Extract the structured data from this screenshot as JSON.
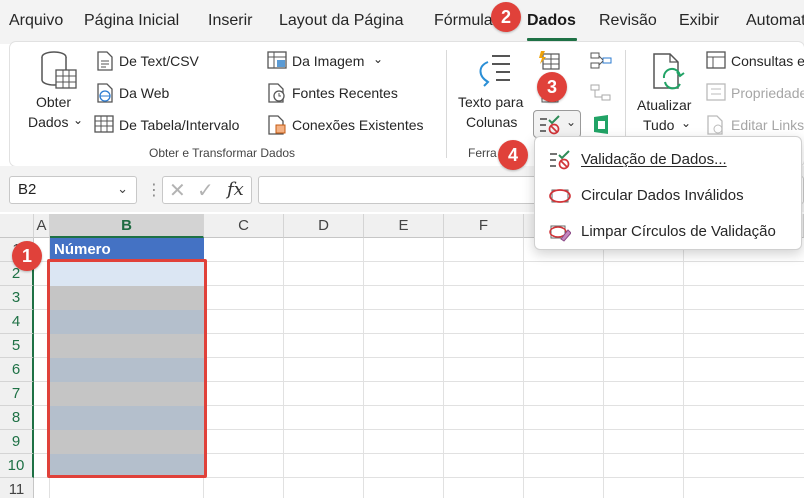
{
  "menu": {
    "tabs": [
      "Arquivo",
      "Página Inicial",
      "Inserir",
      "Layout da Página",
      "Fórmulas",
      "Dados",
      "Revisão",
      "Exibir",
      "Automatizar"
    ],
    "active_tab": "Dados"
  },
  "ribbon": {
    "get_transform": {
      "get_data_line1": "Obter",
      "get_data_line2": "Dados",
      "from_text_csv": "De Text/CSV",
      "from_web": "Da Web",
      "from_table": "De Tabela/Intervalo",
      "from_image": "Da Imagem",
      "recent_sources": "Fontes Recentes",
      "existing_connections": "Conexões Existentes",
      "group_label": "Obter e Transformar Dados"
    },
    "data_tools": {
      "text_to_columns_line1": "Texto para",
      "text_to_columns_line2": "Colunas",
      "group_label_visible": "Ferra"
    },
    "queries": {
      "refresh_line1": "Atualizar",
      "refresh_line2": "Tudo",
      "queries_connections": "Consultas e",
      "properties": "Propriedade",
      "edit_links": "Editar Links"
    }
  },
  "formula_bar": {
    "name_box": "B2",
    "fx_label": "fx",
    "formula": ""
  },
  "grid": {
    "columns": [
      "A",
      "B",
      "C",
      "D",
      "E",
      "F"
    ],
    "selected_column": "B",
    "rows": [
      "1",
      "2",
      "3",
      "4",
      "5",
      "6",
      "7",
      "8",
      "9",
      "10",
      "11"
    ],
    "header_cell": "Número"
  },
  "dropdown": {
    "items": [
      {
        "label": "Validação de Dados...",
        "icon": "data-validation-icon"
      },
      {
        "label": "Circular Dados Inválidos",
        "icon": "circle-invalid-icon"
      },
      {
        "label": "Limpar Círculos de Validação",
        "icon": "clear-circles-icon"
      }
    ]
  },
  "badges": [
    "1",
    "2",
    "3",
    "4"
  ],
  "colors": {
    "accent_green": "#1e7145",
    "highlight_red": "#e0413a",
    "header_blue": "#4472c4",
    "band_blue_gray": "#b4bfcc",
    "band_gray": "#c5c5c5"
  }
}
